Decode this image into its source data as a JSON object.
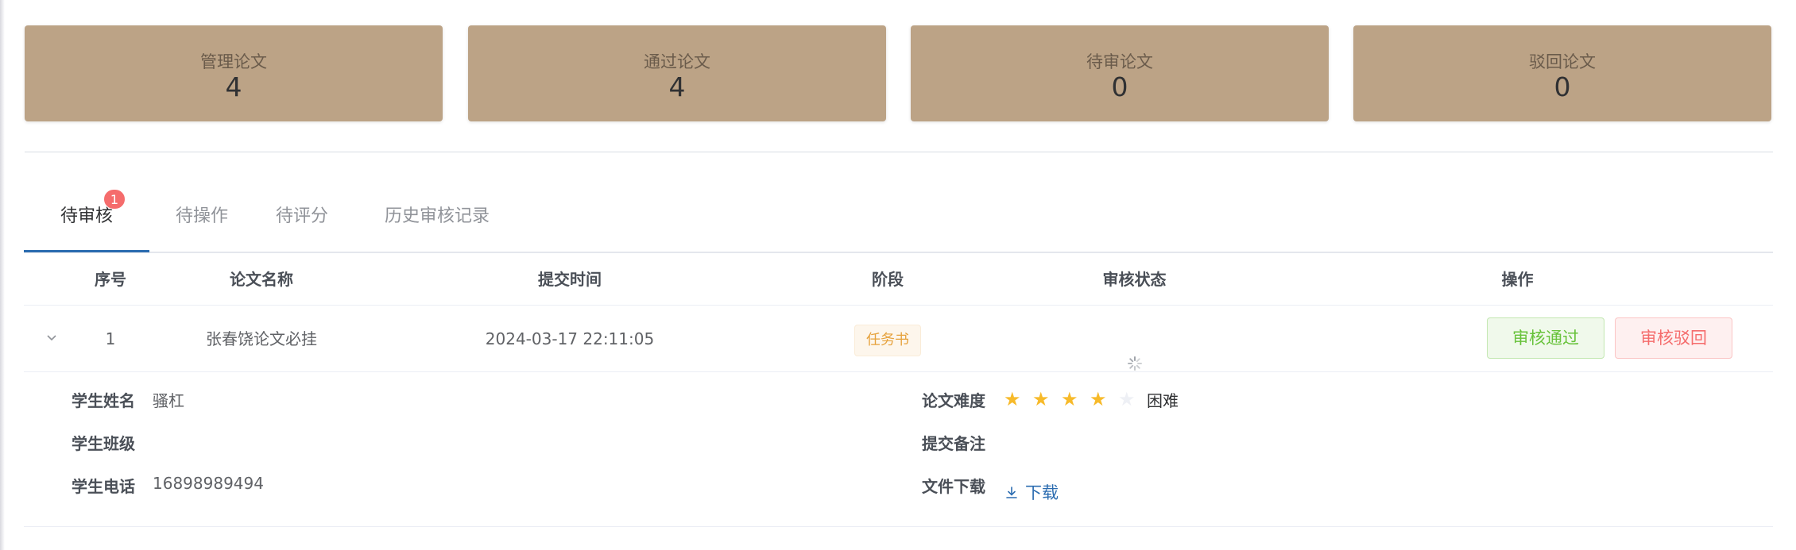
{
  "stats": [
    {
      "label": "管理论文",
      "value": "4"
    },
    {
      "label": "通过论文",
      "value": "4"
    },
    {
      "label": "待审论文",
      "value": "0"
    },
    {
      "label": "驳回论文",
      "value": "0"
    }
  ],
  "tabs": [
    {
      "label": "待审核",
      "badge": "1",
      "active": true
    },
    {
      "label": "待操作"
    },
    {
      "label": "待评分"
    },
    {
      "label": "历史审核记录"
    }
  ],
  "table": {
    "headers": {
      "seq": "序号",
      "name": "论文名称",
      "time": "提交时间",
      "stage": "阶段",
      "status": "审核状态",
      "op": "操作"
    },
    "row": {
      "seq": "1",
      "name": "张春饶论文必挂",
      "time": "2024-03-17 22:11:05",
      "stage": "任务书",
      "status_icon": "loading-icon",
      "pass_label": "审核通过",
      "reject_label": "审核驳回"
    },
    "detail": {
      "student_name_label": "学生姓名",
      "student_name": "骚杠",
      "student_class_label": "学生班级",
      "student_class": "",
      "student_phone_label": "学生电话",
      "student_phone": "16898989494",
      "difficulty_label": "论文难度",
      "difficulty_rating": 4,
      "difficulty_max": 5,
      "difficulty_text": "困难",
      "remark_label": "提交备注",
      "remark": "",
      "download_label": "文件下载",
      "download_text": "下载"
    }
  },
  "colors": {
    "card_bg": "#bca386",
    "active_tab": "#2b6cb0",
    "badge": "#f56c6c",
    "pass": "#67c23a",
    "reject": "#f56c6c",
    "warning_tag": "#e6a23c",
    "star_on": "#f7ba2a"
  }
}
